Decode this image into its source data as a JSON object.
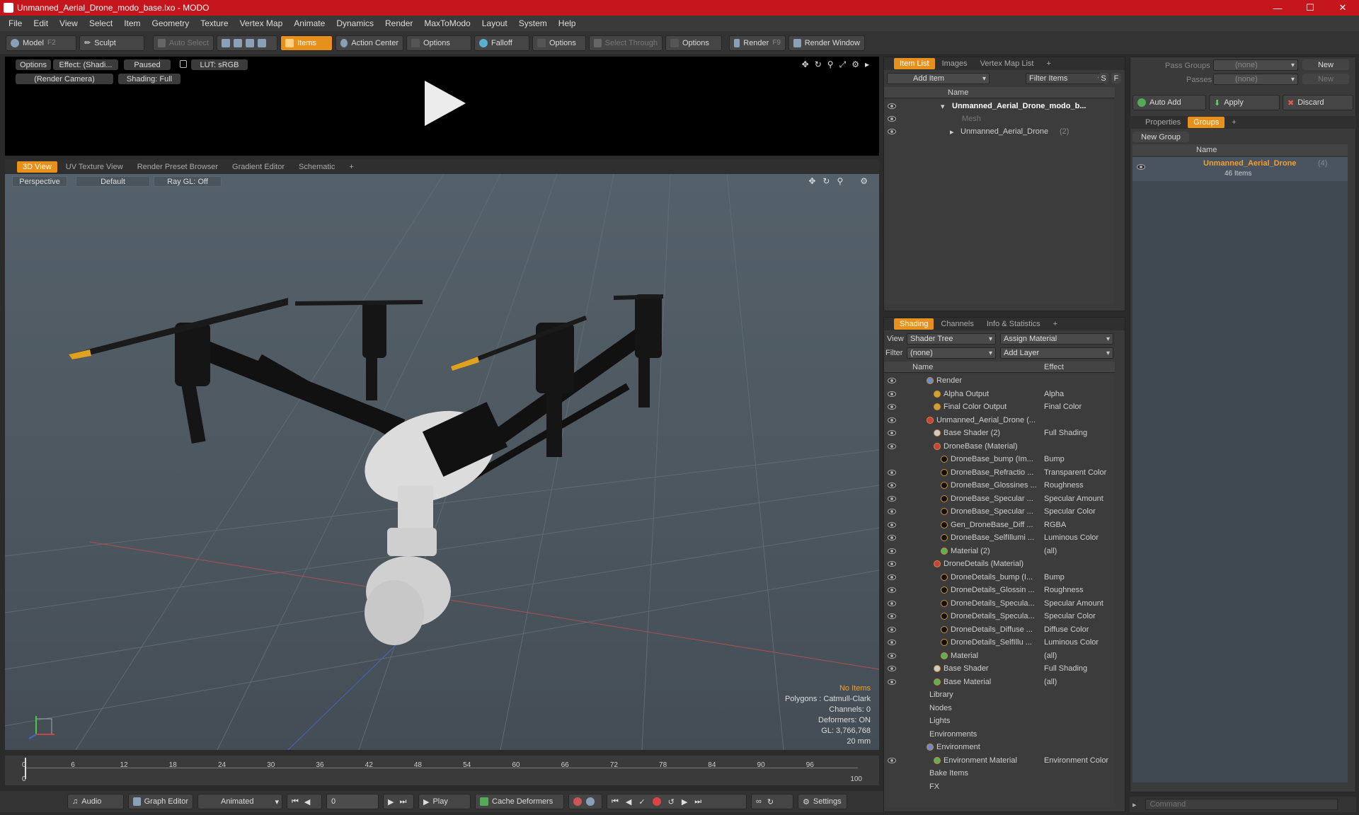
{
  "window": {
    "title": "Unmanned_Aerial_Drone_modo_base.lxo - MODO"
  },
  "menu": [
    "File",
    "Edit",
    "View",
    "Select",
    "Item",
    "Geometry",
    "Texture",
    "Vertex Map",
    "Animate",
    "Dynamics",
    "Render",
    "MaxToModo",
    "Layout",
    "System",
    "Help"
  ],
  "toolbar": {
    "model": "Model",
    "model_key": "F2",
    "sculpt": "Sculpt",
    "auto_select": "Auto Select",
    "items": "Items",
    "action_center": "Action Center",
    "options1": "Options",
    "falloff": "Falloff",
    "options2": "Options",
    "select_through": "Select Through",
    "options3": "Options",
    "render": "Render",
    "render_key": "F9",
    "render_window": "Render Window"
  },
  "render_preview": {
    "options": "Options",
    "effect": "Effect: (Shadi...",
    "paused": "Paused",
    "lut": "LUT: sRGB",
    "camera": "(Render Camera)",
    "shading": "Shading: Full"
  },
  "viewport_tabs": [
    "3D View",
    "UV Texture View",
    "Render Preset Browser",
    "Gradient Editor",
    "Schematic"
  ],
  "viewport": {
    "projection": "Perspective",
    "style": "Default",
    "raygl": "Ray GL: Off",
    "info": {
      "selection": "No Items",
      "polygons": "Polygons : Catmull-Clark",
      "channels": "Channels: 0",
      "deformers": "Deformers: ON",
      "gl": "GL: 3,766,768",
      "scale": "20 mm"
    }
  },
  "timeline": {
    "ticks": [
      "0",
      "6",
      "12",
      "18",
      "24",
      "30",
      "36",
      "42",
      "48",
      "54",
      "60",
      "66",
      "72",
      "78",
      "84",
      "90",
      "96"
    ],
    "start": "0",
    "end": "100"
  },
  "bottom": {
    "audio": "Audio",
    "graph_editor": "Graph Editor",
    "animated": "Animated",
    "frame": "0",
    "play": "Play",
    "cache": "Cache Deformers",
    "settings": "Settings"
  },
  "item_list": {
    "tabs": [
      "Item List",
      "Images",
      "Vertex Map List"
    ],
    "add_item": "Add Item",
    "filter": "Filter Items",
    "name_header": "Name",
    "rows": [
      {
        "label": "Unmanned_Aerial_Drone_modo_b...",
        "extra": ""
      },
      {
        "label": "Mesh",
        "extra": ""
      },
      {
        "label": "Unmanned_Aerial_Drone",
        "extra": "(2)"
      }
    ]
  },
  "shading": {
    "tabs": [
      "Shading",
      "Channels",
      "Info & Statistics"
    ],
    "view_label": "View",
    "view_value": "Shader Tree",
    "assign": "Assign Material",
    "filter_label": "Filter",
    "filter_value": "(none)",
    "add_layer": "Add Layer",
    "name_header": "Name",
    "effect_header": "Effect",
    "rows": [
      {
        "name": "Render",
        "effect": ""
      },
      {
        "name": "Alpha Output",
        "effect": "Alpha"
      },
      {
        "name": "Final Color Output",
        "effect": "Final Color"
      },
      {
        "name": "Unmanned_Aerial_Drone (...",
        "effect": ""
      },
      {
        "name": "Base Shader (2)",
        "effect": "Full Shading"
      },
      {
        "name": "DroneBase (Material)",
        "effect": ""
      },
      {
        "name": "DroneBase_bump (Im...",
        "effect": "Bump"
      },
      {
        "name": "DroneBase_Refractio ...",
        "effect": "Transparent Color"
      },
      {
        "name": "DroneBase_Glossines ...",
        "effect": "Roughness"
      },
      {
        "name": "DroneBase_Specular ...",
        "effect": "Specular Amount"
      },
      {
        "name": "DroneBase_Specular ...",
        "effect": "Specular Color"
      },
      {
        "name": "Gen_DroneBase_Diff ...",
        "effect": "RGBA"
      },
      {
        "name": "DroneBase_SelfIllumi ...",
        "effect": "Luminous Color"
      },
      {
        "name": "Material (2)",
        "effect": "(all)"
      },
      {
        "name": "DroneDetails (Material)",
        "effect": ""
      },
      {
        "name": "DroneDetails_bump (I...",
        "effect": "Bump"
      },
      {
        "name": "DroneDetails_Glossin ...",
        "effect": "Roughness"
      },
      {
        "name": "DroneDetails_Specula...",
        "effect": "Specular Amount"
      },
      {
        "name": "DroneDetails_Specula...",
        "effect": "Specular Color"
      },
      {
        "name": "DroneDetails_Diffuse ...",
        "effect": "Diffuse Color"
      },
      {
        "name": "DroneDetails_SelfIllu ...",
        "effect": "Luminous Color"
      },
      {
        "name": "Material",
        "effect": "(all)"
      },
      {
        "name": "Base Shader",
        "effect": "Full Shading"
      },
      {
        "name": "Base Material",
        "effect": "(all)"
      },
      {
        "name": "Library",
        "effect": ""
      },
      {
        "name": "Nodes",
        "effect": ""
      },
      {
        "name": "Lights",
        "effect": ""
      },
      {
        "name": "Environments",
        "effect": ""
      },
      {
        "name": "Environment",
        "effect": ""
      },
      {
        "name": "Environment Material",
        "effect": "Environment Color"
      },
      {
        "name": "Bake Items",
        "effect": ""
      },
      {
        "name": "FX",
        "effect": ""
      }
    ]
  },
  "groups": {
    "pass_groups": "Pass Groups",
    "pass_groups_value": "(none)",
    "new": "New",
    "passes": "Passes",
    "passes_value": "(none)",
    "new2": "New",
    "auto_add": "Auto Add",
    "apply": "Apply",
    "discard": "Discard",
    "tabs": [
      "Properties",
      "Groups"
    ],
    "new_group": "New Group",
    "name_header": "Name",
    "item_name": "Unmanned_Aerial_Drone",
    "item_count": "(4)",
    "item_sub": "46 Items"
  },
  "command": {
    "placeholder": "Command"
  }
}
